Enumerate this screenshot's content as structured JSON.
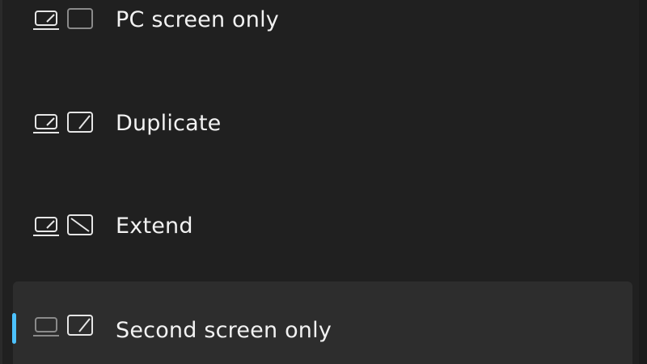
{
  "project_menu": {
    "options": [
      {
        "label": "PC screen only",
        "icon": "pc-screen-only-icon",
        "selected": false
      },
      {
        "label": "Duplicate",
        "icon": "duplicate-icon",
        "selected": false
      },
      {
        "label": "Extend",
        "icon": "extend-icon",
        "selected": false
      },
      {
        "label": "Second screen only",
        "icon": "second-screen-only-icon",
        "selected": true
      }
    ],
    "colors": {
      "background": "#202020",
      "selected_background": "#2d2d2d",
      "accent": "#4cc2ff",
      "text": "#f2f2f2",
      "icon_active": "#e6e6e6",
      "icon_inactive": "#8a8a8a"
    }
  }
}
